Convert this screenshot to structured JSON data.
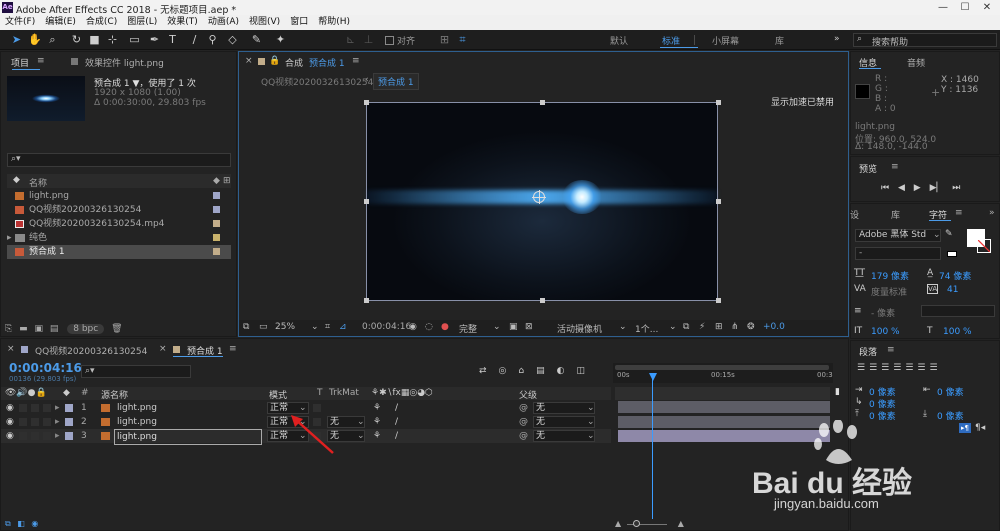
{
  "titlebar": {
    "app_icon": "Ae",
    "title": "Adobe After Effects CC 2018 - 无标题项目.aep *",
    "minimize": "—",
    "maximize": "☐",
    "close": "✕"
  },
  "menu": [
    "文件(F)",
    "编辑(E)",
    "合成(C)",
    "图层(L)",
    "效果(T)",
    "动画(A)",
    "视图(V)",
    "窗口",
    "帮助(H)"
  ],
  "toolbar": {
    "snap_label": "对齐",
    "workspaces": [
      "默认",
      "标准",
      "小屏幕",
      "库"
    ],
    "active_workspace": "标准",
    "search_placeholder": "搜索帮助"
  },
  "project": {
    "tab": "项目",
    "effects_tab": "效果控件 light.png",
    "comp_name": "预合成 1 ▼",
    "usage": "，使用了 1 次",
    "size": "1920 x 1080 (1.00)",
    "duration": "Δ 0:00:30:00, 29.803 fps",
    "col_name": "名称",
    "items": [
      {
        "name": "light.png",
        "color": "#9fa6c8",
        "type": "img"
      },
      {
        "name": "QQ视频20200326130254",
        "color": "#9fa6c8",
        "type": "comp"
      },
      {
        "name": "QQ视频20200326130254.mp4",
        "color": "#c2ad8a",
        "type": "video"
      },
      {
        "name": "纯色",
        "color": "#c9b26b",
        "type": "folder"
      },
      {
        "name": "预合成 1",
        "color": "#c2ad8a",
        "type": "comp",
        "selected": true
      }
    ],
    "bpc": "8 bpc"
  },
  "comp_panel": {
    "tab_close": "×",
    "tab_title": "合成",
    "tab_name": "预合成 1",
    "breadcrumb_parent": "QQ视频20200326130254",
    "breadcrumb_active": "预合成 1",
    "gpu_notice": "显示加速已禁用",
    "zoom": "25%",
    "timecode": "0:00:04:16",
    "quality": "完整",
    "camera": "活动摄像机",
    "views": "1个...",
    "exposure": "+0.0"
  },
  "info": {
    "tab": "信息",
    "audio_tab": "音频",
    "r": "R :",
    "g": "G :",
    "b": "B :",
    "a": "A : 0",
    "x": "X : 1460",
    "y": "Y : 1136",
    "layer": "light.png",
    "position": "位置: 960.0, 524.0",
    "delta": "Δ: 148.0, -144.0"
  },
  "preview": {
    "tab": "预览"
  },
  "character": {
    "tabs": [
      "设",
      "库",
      "字符"
    ],
    "font": "Adobe 黑体 Std",
    "style": "-",
    "size": "179 像素",
    "leading": "74 像素",
    "kerning": "度量标准",
    "tracking": "41",
    "stroke": "- 像素",
    "vscale": "100 %",
    "hscale": "100 %"
  },
  "paragraph": {
    "tab": "段落",
    "v1": "0 像素",
    "v2": "0 像素",
    "v3": "0 像素",
    "v4": "0 像素",
    "v5": "0 像素"
  },
  "timeline": {
    "tab1": "QQ视频20200326130254",
    "tab2": "预合成 1",
    "timecode": "0:00:04:16",
    "frame_info": "00136 (29.803 fps)",
    "col_src": "源名称",
    "col_mode": "模式",
    "col_t": "T",
    "col_trkmat": "TrkMat",
    "col_parent": "父级",
    "ruler": [
      "00s",
      "00:15s",
      "00:3"
    ],
    "layers": [
      {
        "num": "1",
        "name": "light.png",
        "mode": "正常",
        "trkmat": "",
        "parent": "无"
      },
      {
        "num": "2",
        "name": "light.png",
        "mode": "正常",
        "trkmat": "无",
        "parent": "无"
      },
      {
        "num": "3",
        "name": "light.png",
        "mode": "正常",
        "trkmat": "无",
        "parent": "无"
      }
    ]
  },
  "watermark": {
    "brand": "Bai du 经验",
    "url": "jingyan.baidu.com"
  }
}
